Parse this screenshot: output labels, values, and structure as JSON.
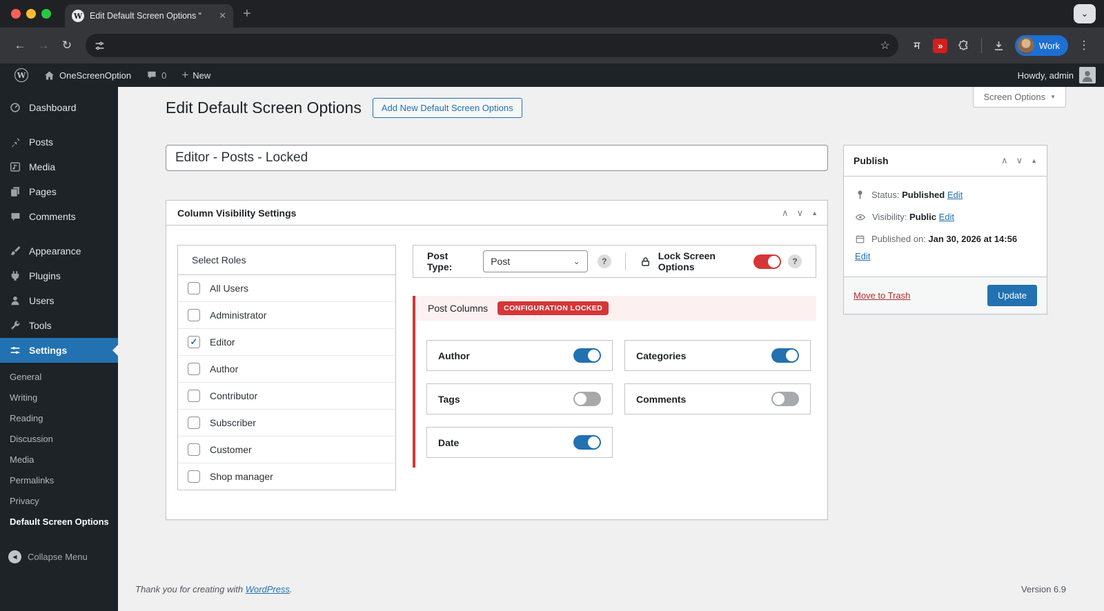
{
  "browser": {
    "tab_title": "Edit Default Screen Options “",
    "profile_label": "Work"
  },
  "icons": {
    "close": "✕",
    "new_tab": "+",
    "window_chevron": "⌄",
    "back_arrow": "←",
    "forward_arrow": "→",
    "reload": "↻",
    "star": "☆",
    "overflow_dots": "⋮",
    "extension_devanagari": "म",
    "extension_forward": "»",
    "wp_w": "W",
    "plus": "+",
    "screen_options_caret": "▼",
    "select_caret": "⌄",
    "help": "?",
    "sort_up": "∧",
    "sort_down": "∨",
    "collapse_caret": "▲",
    "collapse_menu_arrow": "◀"
  },
  "admin_bar": {
    "site_name": "OneScreenOption",
    "comment_count": "0",
    "new_label": "New",
    "howdy": "Howdy, admin"
  },
  "sidebar": {
    "items": [
      {
        "label": "Dashboard"
      },
      {
        "label": "Posts"
      },
      {
        "label": "Media"
      },
      {
        "label": "Pages"
      },
      {
        "label": "Comments"
      },
      {
        "label": "Appearance"
      },
      {
        "label": "Plugins"
      },
      {
        "label": "Users"
      },
      {
        "label": "Tools"
      },
      {
        "label": "Settings",
        "active": true
      }
    ],
    "settings_submenu": [
      {
        "label": "General"
      },
      {
        "label": "Writing"
      },
      {
        "label": "Reading"
      },
      {
        "label": "Discussion"
      },
      {
        "label": "Media"
      },
      {
        "label": "Permalinks"
      },
      {
        "label": "Privacy"
      },
      {
        "label": "Default Screen Options",
        "current": true
      }
    ],
    "collapse_label": "Collapse Menu"
  },
  "page": {
    "screen_options_label": "Screen Options",
    "title": "Edit Default Screen Options",
    "add_new_label": "Add New Default Screen Options",
    "post_title": "Editor - Posts - Locked",
    "panel": {
      "title": "Column Visibility Settings",
      "roles": {
        "header": "Select Roles",
        "items": [
          {
            "label": "All Users",
            "checked": false
          },
          {
            "label": "Administrator",
            "checked": false
          },
          {
            "label": "Editor",
            "checked": true
          },
          {
            "label": "Author",
            "checked": false
          },
          {
            "label": "Contributor",
            "checked": false
          },
          {
            "label": "Subscriber",
            "checked": false
          },
          {
            "label": "Customer",
            "checked": false
          },
          {
            "label": "Shop manager",
            "checked": false
          }
        ]
      },
      "post_type_label": "Post Type:",
      "post_type_value": "Post",
      "lock_label": "Lock Screen Options",
      "lock_enabled": true,
      "columns": {
        "title": "Post Columns",
        "badge": "CONFIGURATION LOCKED",
        "toggles": [
          {
            "label": "Author",
            "on": true
          },
          {
            "label": "Categories",
            "on": true
          },
          {
            "label": "Tags",
            "on": false
          },
          {
            "label": "Comments",
            "on": false
          },
          {
            "label": "Date",
            "on": true
          }
        ]
      }
    },
    "publish": {
      "title": "Publish",
      "status_label": "Status:",
      "status_value": "Published",
      "visibility_label": "Visibility:",
      "visibility_value": "Public",
      "published_label": "Published on:",
      "published_value": "Jan 30, 2026 at 14:56",
      "edit_label": "Edit",
      "trash_label": "Move to Trash",
      "update_label": "Update"
    },
    "footer": {
      "thanks_prefix": "Thank you for creating with ",
      "wordpress_label": "WordPress",
      "thanks_suffix": ".",
      "version": "Version 6.9"
    }
  },
  "colors": {
    "accent_blue": "#2271b1",
    "danger_red": "#d63638",
    "locked_banner_bg": "#fcf0f1",
    "admin_dark": "#1d2327"
  }
}
